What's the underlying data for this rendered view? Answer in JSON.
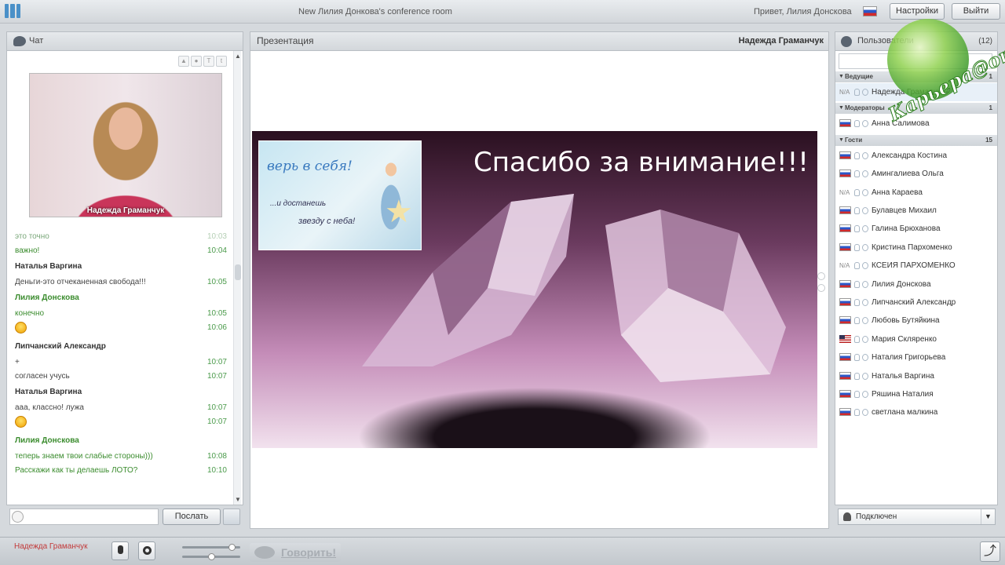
{
  "window": {
    "room_title": "New Лилия Донкова's conference room",
    "greeting": "Привет, Лилия Донскова",
    "settings_label": "Настройки",
    "logout_label": "Выйти"
  },
  "chat": {
    "title": "Чат",
    "video_caption": "Надежда Граманчук",
    "messages": [
      {
        "kind": "msg",
        "text": "это точно",
        "time": "10:03",
        "faded": true
      },
      {
        "kind": "msg",
        "text": "важно!",
        "time": "10:04",
        "green": true
      },
      {
        "kind": "author",
        "text": "Наталья Варгина"
      },
      {
        "kind": "msg",
        "text": "Деньги-это отчеканенная свобода!!!",
        "time": "10:05"
      },
      {
        "kind": "author",
        "text": "Лилия Донскова",
        "green": true
      },
      {
        "kind": "msg",
        "text": "конечно",
        "time": "10:05",
        "green": true
      },
      {
        "kind": "smile",
        "time": "10:06"
      },
      {
        "kind": "author",
        "text": "Липчанский Александр"
      },
      {
        "kind": "msg",
        "text": "+",
        "time": "10:07"
      },
      {
        "kind": "msg",
        "text": "согласен учусь",
        "time": "10:07"
      },
      {
        "kind": "author",
        "text": "Наталья Варгина"
      },
      {
        "kind": "msg",
        "text": "ааа, классно! лужа",
        "time": "10:07"
      },
      {
        "kind": "smile",
        "time": "10:07"
      },
      {
        "kind": "author",
        "text": "Лилия Донскова",
        "green": true
      },
      {
        "kind": "msg",
        "text": "теперь знаем твои слабые стороны)))",
        "time": "10:08",
        "green": true
      },
      {
        "kind": "msg",
        "text": "Расскажи как ты делаешь ЛОТО?",
        "time": "10:10",
        "green": true
      }
    ],
    "input_placeholder": "",
    "send_label": "Послать"
  },
  "presentation": {
    "title": "Презентация",
    "presenter": "Надежда Граманчук",
    "slide_title": "Спасибо за внимание!!!",
    "inset_line1": "верь в себя!",
    "inset_line2": "...и достанешь",
    "inset_line3": "звезду с неба!"
  },
  "users": {
    "title": "Пользователи",
    "count": "(12)",
    "groups": [
      {
        "label": "Ведущие",
        "count": "1",
        "users": [
          {
            "name": "Надежда Граманчук",
            "flag": "na",
            "sel": true
          }
        ]
      },
      {
        "label": "Модераторы",
        "count": "1",
        "users": [
          {
            "name": "Анна Салимова",
            "flag": "ru"
          }
        ]
      },
      {
        "label": "Гости",
        "count": "15",
        "users": [
          {
            "name": "Александра Костина",
            "flag": "ru"
          },
          {
            "name": "Амингалиева Ольга",
            "flag": "ru"
          },
          {
            "name": "Анна Караева",
            "flag": "na"
          },
          {
            "name": "Булавцев Михаил",
            "flag": "ru"
          },
          {
            "name": "Галина Брюханова",
            "flag": "ru"
          },
          {
            "name": "Кристина Пархоменко",
            "flag": "ru"
          },
          {
            "name": "КСЕИЯ ПАРХОМЕНКО",
            "flag": "na"
          },
          {
            "name": "Лилия Донскова",
            "flag": "ru"
          },
          {
            "name": "Липчанский Александр",
            "flag": "ru"
          },
          {
            "name": "Любовь Бутяйкина",
            "flag": "ru"
          },
          {
            "name": "Мария Скляренко",
            "flag": "us"
          },
          {
            "name": "Наталия Григорьева",
            "flag": "ru"
          },
          {
            "name": "Наталья Варгина",
            "flag": "ru"
          },
          {
            "name": "Ряшина Наталия",
            "flag": "ru"
          },
          {
            "name": "светлана малкина",
            "flag": "ru"
          }
        ]
      }
    ],
    "status": "Подключен"
  },
  "watermark": "Карьера@online",
  "bottom": {
    "current_user": "Надежда Граманчук",
    "talk_label": "Говорить!",
    "mic_volume": 0.85,
    "speaker_volume": 0.5
  }
}
